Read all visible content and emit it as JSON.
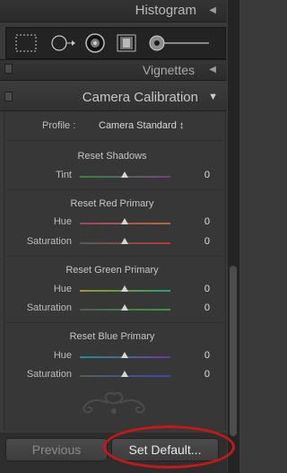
{
  "panels": {
    "histogram": {
      "title": "Histogram",
      "toggle_icon": "triangle-left"
    },
    "vignettes": {
      "title": "Vignettes",
      "toggle_icon": "triangle-left"
    },
    "camera_calibration": {
      "title": "Camera Calibration",
      "toggle_icon": "triangle-down"
    }
  },
  "toolbar": {
    "tools": [
      "crop-overlay-icon",
      "spot-removal-icon",
      "red-eye-icon",
      "graduated-filter-icon",
      "adjustment-brush-icon"
    ]
  },
  "calibration": {
    "profile_label": "Profile :",
    "profile_value": "Camera Standard ↕",
    "shadows": {
      "title": "Reset Shadows",
      "tint_label": "Tint",
      "tint_value": "0"
    },
    "red": {
      "title": "Reset Red Primary",
      "hue_label": "Hue",
      "hue_value": "0",
      "sat_label": "Saturation",
      "sat_value": "0"
    },
    "green": {
      "title": "Reset Green Primary",
      "hue_label": "Hue",
      "hue_value": "0",
      "sat_label": "Saturation",
      "sat_value": "0"
    },
    "blue": {
      "title": "Reset Blue Primary",
      "hue_label": "Hue",
      "hue_value": "0",
      "sat_label": "Saturation",
      "sat_value": "0"
    }
  },
  "footer": {
    "previous_label": "Previous",
    "set_default_label": "Set Default..."
  },
  "colors": {
    "highlight_ring": "#c8171a"
  }
}
